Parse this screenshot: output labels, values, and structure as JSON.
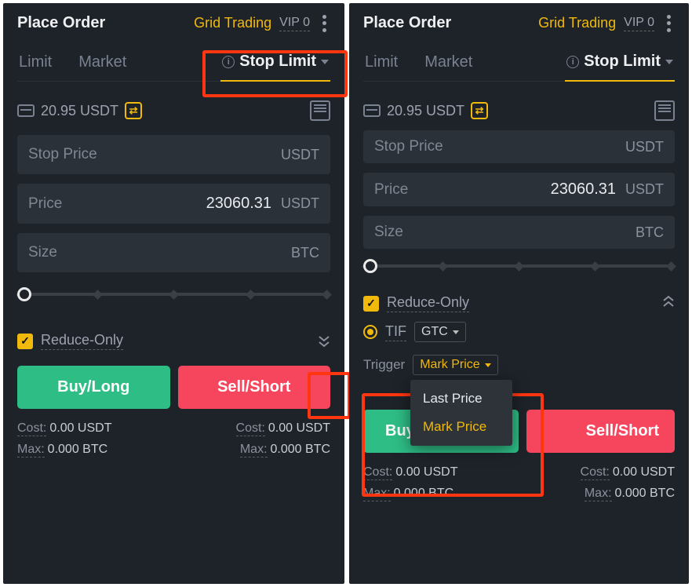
{
  "left": {
    "title": "Place Order",
    "grid_trading": "Grid Trading",
    "vip": "VIP 0",
    "tabs": {
      "limit": "Limit",
      "market": "Market",
      "stop_limit": "Stop Limit"
    },
    "balance": "20.95 USDT",
    "fields": {
      "stop_price_label": "Stop Price",
      "stop_price_unit": "USDT",
      "price_label": "Price",
      "price_value": "23060.31",
      "price_unit": "USDT",
      "size_label": "Size",
      "size_unit": "BTC"
    },
    "reduce_only": "Reduce-Only",
    "buy": "Buy/Long",
    "sell": "Sell/Short",
    "stats": {
      "cost_label": "Cost:",
      "cost_value": "0.00 USDT",
      "max_label": "Max:",
      "max_value": "0.000 BTC"
    }
  },
  "right": {
    "title": "Place Order",
    "grid_trading": "Grid Trading",
    "vip": "VIP 0",
    "tabs": {
      "limit": "Limit",
      "market": "Market",
      "stop_limit": "Stop Limit"
    },
    "balance": "20.95 USDT",
    "fields": {
      "stop_price_label": "Stop Price",
      "stop_price_unit": "USDT",
      "price_label": "Price",
      "price_value": "23060.31",
      "price_unit": "USDT",
      "size_label": "Size",
      "size_unit": "BTC"
    },
    "reduce_only": "Reduce-Only",
    "tif_label": "TIF",
    "tif_value": "GTC",
    "trigger_label": "Trigger",
    "trigger_value": "Mark Price",
    "trigger_options": {
      "opt1": "Last Price",
      "opt2": "Mark Price"
    },
    "buy": "Buy/",
    "sell": "Sell/Short",
    "stats": {
      "cost_label": "Cost:",
      "cost_value": "0.00 USDT",
      "max_label": "Max:",
      "max_value": "0.000 BTC"
    }
  }
}
